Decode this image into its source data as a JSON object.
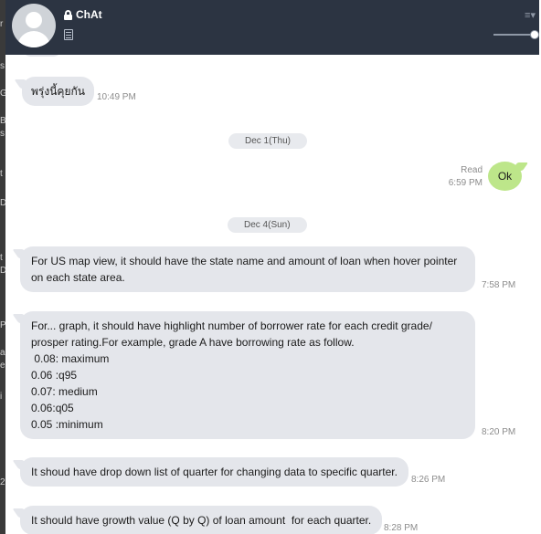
{
  "header": {
    "title": "ChAt"
  },
  "left_strip": [
    "r",
    "s",
    "G",
    "B",
    "s",
    "t",
    "D",
    "t",
    "D",
    "P",
    "a",
    "e",
    "i",
    "2"
  ],
  "date_dividers": [
    "Dec 1(Thu)",
    "Dec 4(Sun)"
  ],
  "messages": [
    {
      "text": "พรุ่งนี้คุยกัน",
      "time": "10:49 PM"
    },
    {
      "text": "Ok",
      "read": "Read",
      "time": "6:59 PM"
    },
    {
      "text": "For US map view, it should have the state name and amount of loan when hover pointer on each state area.",
      "time": "7:58 PM"
    },
    {
      "lines": [
        "For... graph, it should have highlight number of borrower rate for each credit grade/ prosper rating.For example, grade A have borrowing rate as follow.",
        " 0.08: maximum",
        "0.06 :q95",
        "0.07: medium",
        "0.06:q05",
        "0.05 :minimum"
      ],
      "time": "8:20 PM"
    },
    {
      "text": "It shoud have drop down list of quarter for changing data to specific quarter.",
      "time": "8:26 PM"
    },
    {
      "text": "It should have growth value (Q by Q) of loan amount  for each quarter.",
      "time": "8:28 PM"
    }
  ]
}
